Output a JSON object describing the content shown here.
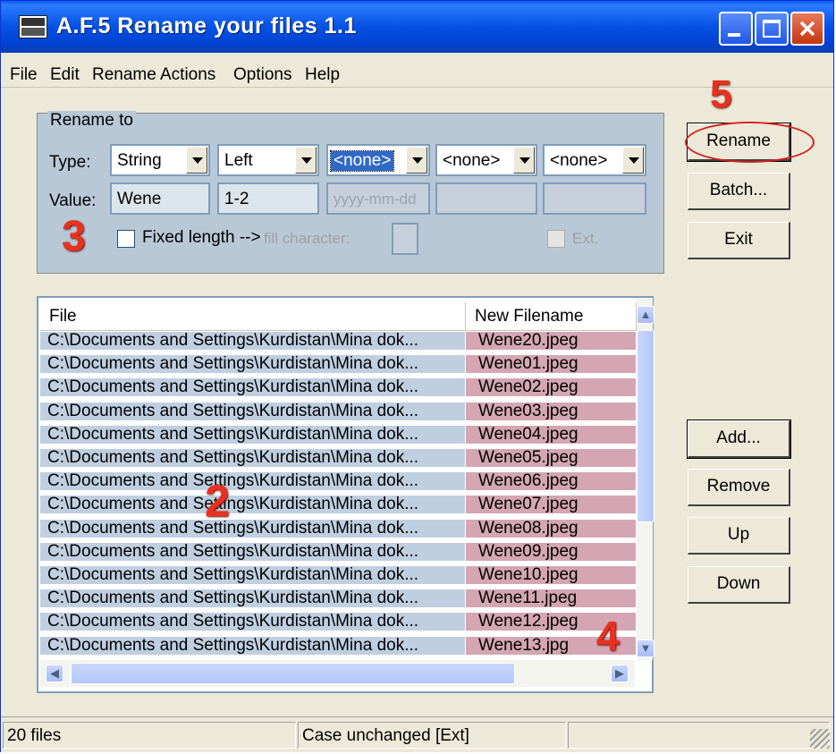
{
  "window": {
    "title": "A.F.5 Rename your files 1.1"
  },
  "menu": [
    "File",
    "Edit",
    "Rename",
    "Actions",
    "Options",
    "Help"
  ],
  "rename_group": {
    "label": "Rename to",
    "type_label": "Type:",
    "value_label": "Value:",
    "types": [
      "String",
      "Left",
      "<none>",
      "<none>",
      "<none>"
    ],
    "values": [
      "Wene",
      "1-2",
      "yyyy-mm-dd",
      "",
      ""
    ],
    "fixed_length_label": "Fixed length -->",
    "fixed_length_checked": false,
    "fill_character_label": "fill character:",
    "ext_label": "Ext.",
    "ext_checked": false
  },
  "buttons": {
    "rename": "Rename",
    "batch": "Batch...",
    "exit": "Exit",
    "add": "Add...",
    "remove": "Remove",
    "up": "Up",
    "down": "Down"
  },
  "file_list": {
    "columns": [
      "File",
      "New Filename"
    ],
    "rows": [
      {
        "file": "C:\\Documents and Settings\\Kurdistan\\Mina dok...",
        "new": "Wene20.jpeg"
      },
      {
        "file": "C:\\Documents and Settings\\Kurdistan\\Mina dok...",
        "new": "Wene01.jpeg"
      },
      {
        "file": "C:\\Documents and Settings\\Kurdistan\\Mina dok...",
        "new": "Wene02.jpeg"
      },
      {
        "file": "C:\\Documents and Settings\\Kurdistan\\Mina dok...",
        "new": "Wene03.jpeg"
      },
      {
        "file": "C:\\Documents and Settings\\Kurdistan\\Mina dok...",
        "new": "Wene04.jpeg"
      },
      {
        "file": "C:\\Documents and Settings\\Kurdistan\\Mina dok...",
        "new": "Wene05.jpeg"
      },
      {
        "file": "C:\\Documents and Settings\\Kurdistan\\Mina dok...",
        "new": "Wene06.jpeg"
      },
      {
        "file": "C:\\Documents and Settings\\Kurdistan\\Mina dok...",
        "new": "Wene07.jpeg"
      },
      {
        "file": "C:\\Documents and Settings\\Kurdistan\\Mina dok...",
        "new": "Wene08.jpeg"
      },
      {
        "file": "C:\\Documents and Settings\\Kurdistan\\Mina dok...",
        "new": "Wene09.jpeg"
      },
      {
        "file": "C:\\Documents and Settings\\Kurdistan\\Mina dok...",
        "new": "Wene10.jpeg"
      },
      {
        "file": "C:\\Documents and Settings\\Kurdistan\\Mina dok...",
        "new": "Wene11.jpeg"
      },
      {
        "file": "C:\\Documents and Settings\\Kurdistan\\Mina dok...",
        "new": "Wene12.jpeg"
      },
      {
        "file": "C:\\Documents and Settings\\Kurdistan\\Mina dok...",
        "new": "Wene13.jpg"
      }
    ]
  },
  "status": {
    "count": "20 files",
    "case": "Case unchanged   [Ext]",
    "extra": ""
  },
  "annotations": [
    "5",
    "3",
    "2",
    "4"
  ],
  "colors": {
    "title_bar": "#0551e4",
    "group_bg": "#b8c8d6",
    "file_col_bg": "#c0cfe0",
    "new_col_bg": "#d4a6b4",
    "annotation": "#e8311e",
    "selection": "#316ac5"
  }
}
